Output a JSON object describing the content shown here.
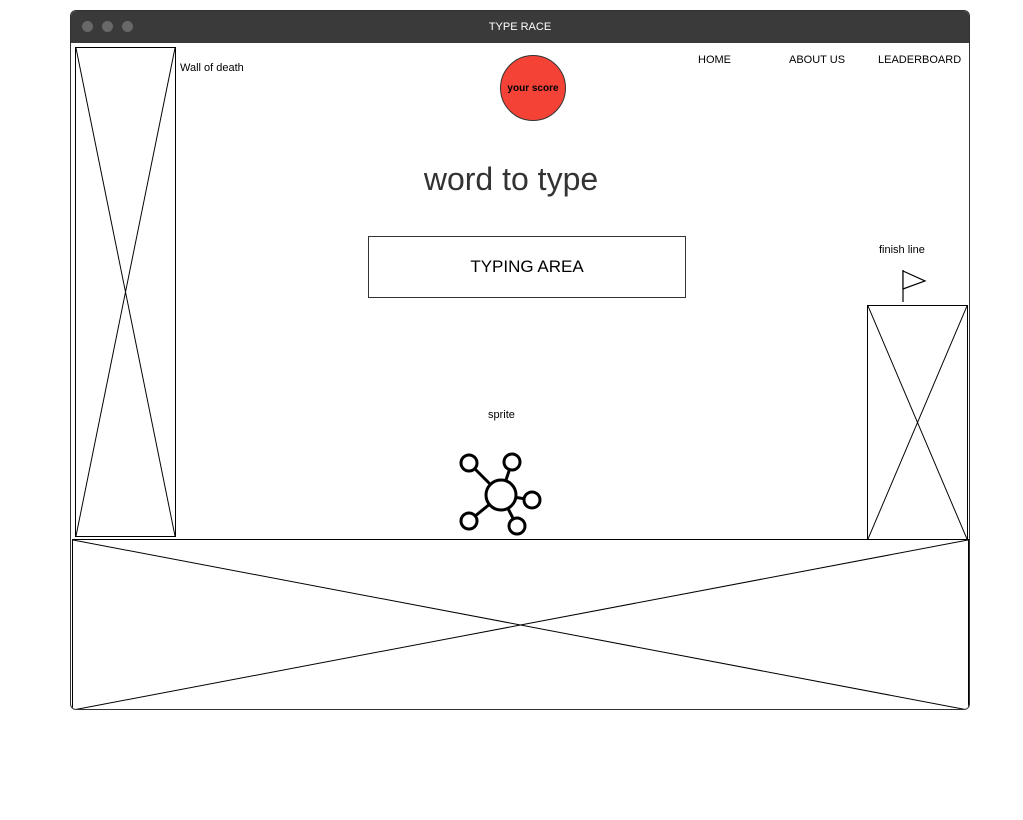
{
  "window": {
    "title": "TYPE RACE"
  },
  "nav": {
    "items": [
      "HOME",
      "ABOUT US",
      "LEADERBOARD"
    ]
  },
  "score": {
    "label": "your score",
    "color": "#f44336"
  },
  "game": {
    "word_to_type": "word to type",
    "typing_area_label": "TYPING AREA",
    "wall_label": "Wall of death",
    "finish_label": "finish line",
    "sprite_label": "sprite"
  },
  "icons": {
    "sprite": "sprite-network-icon",
    "finish_flag": "flag-icon"
  }
}
